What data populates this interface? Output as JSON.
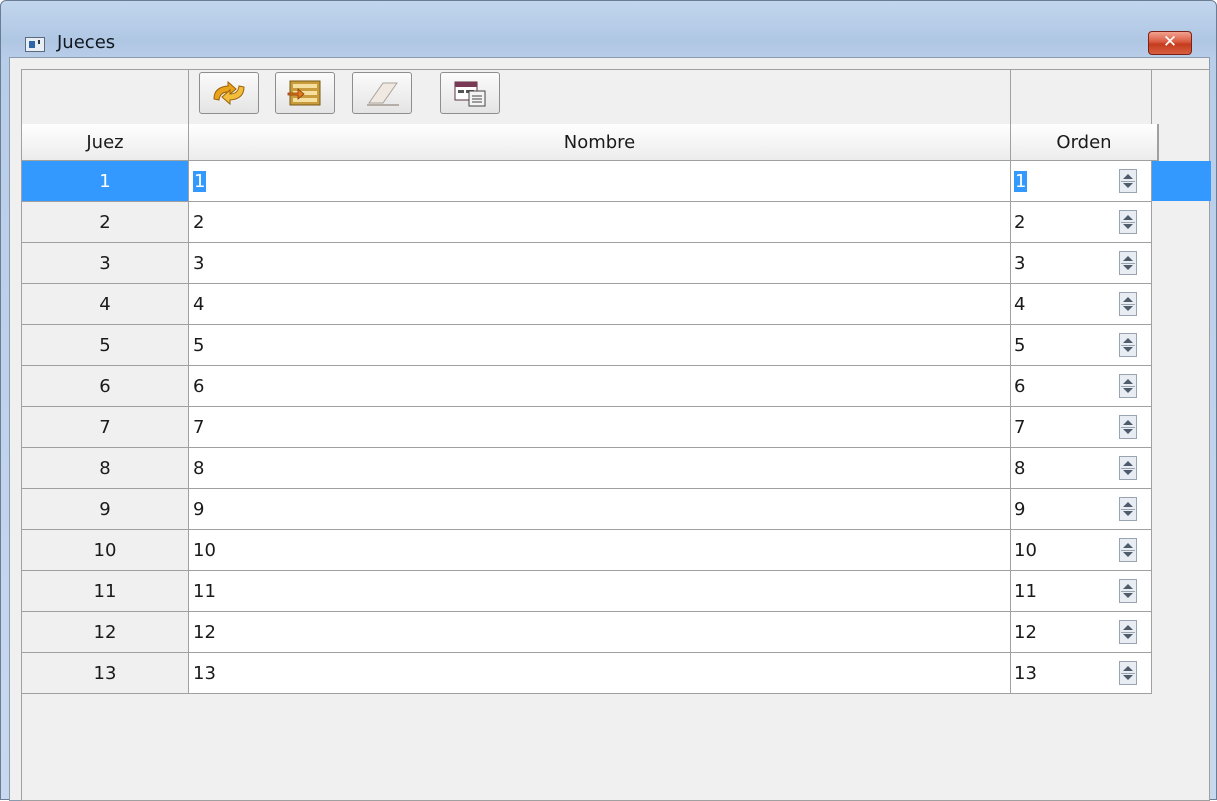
{
  "window": {
    "title": "Jueces",
    "close_label": "✕"
  },
  "toolbar": {
    "buttons": [
      {
        "icon": "refresh-arrows-icon"
      },
      {
        "icon": "add-rows-icon"
      },
      {
        "icon": "eraser-icon"
      },
      {
        "icon": "table-export-icon"
      }
    ]
  },
  "table": {
    "columns": [
      "Juez",
      "Nombre",
      "Orden"
    ],
    "selected_row": 1,
    "rows": [
      {
        "juez": "1",
        "nombre": "1",
        "orden": "1"
      },
      {
        "juez": "2",
        "nombre": "2",
        "orden": "2"
      },
      {
        "juez": "3",
        "nombre": "3",
        "orden": "3"
      },
      {
        "juez": "4",
        "nombre": "4",
        "orden": "4"
      },
      {
        "juez": "5",
        "nombre": "5",
        "orden": "5"
      },
      {
        "juez": "6",
        "nombre": "6",
        "orden": "6"
      },
      {
        "juez": "7",
        "nombre": "7",
        "orden": "7"
      },
      {
        "juez": "8",
        "nombre": "8",
        "orden": "8"
      },
      {
        "juez": "9",
        "nombre": "9",
        "orden": "9"
      },
      {
        "juez": "10",
        "nombre": "10",
        "orden": "10"
      },
      {
        "juez": "11",
        "nombre": "11",
        "orden": "11"
      },
      {
        "juez": "12",
        "nombre": "12",
        "orden": "12"
      },
      {
        "juez": "13",
        "nombre": "13",
        "orden": "13"
      }
    ]
  },
  "colors": {
    "selection": "#3399ff",
    "close_button": "#d95a40",
    "title_bar": "#b9cfe9"
  }
}
